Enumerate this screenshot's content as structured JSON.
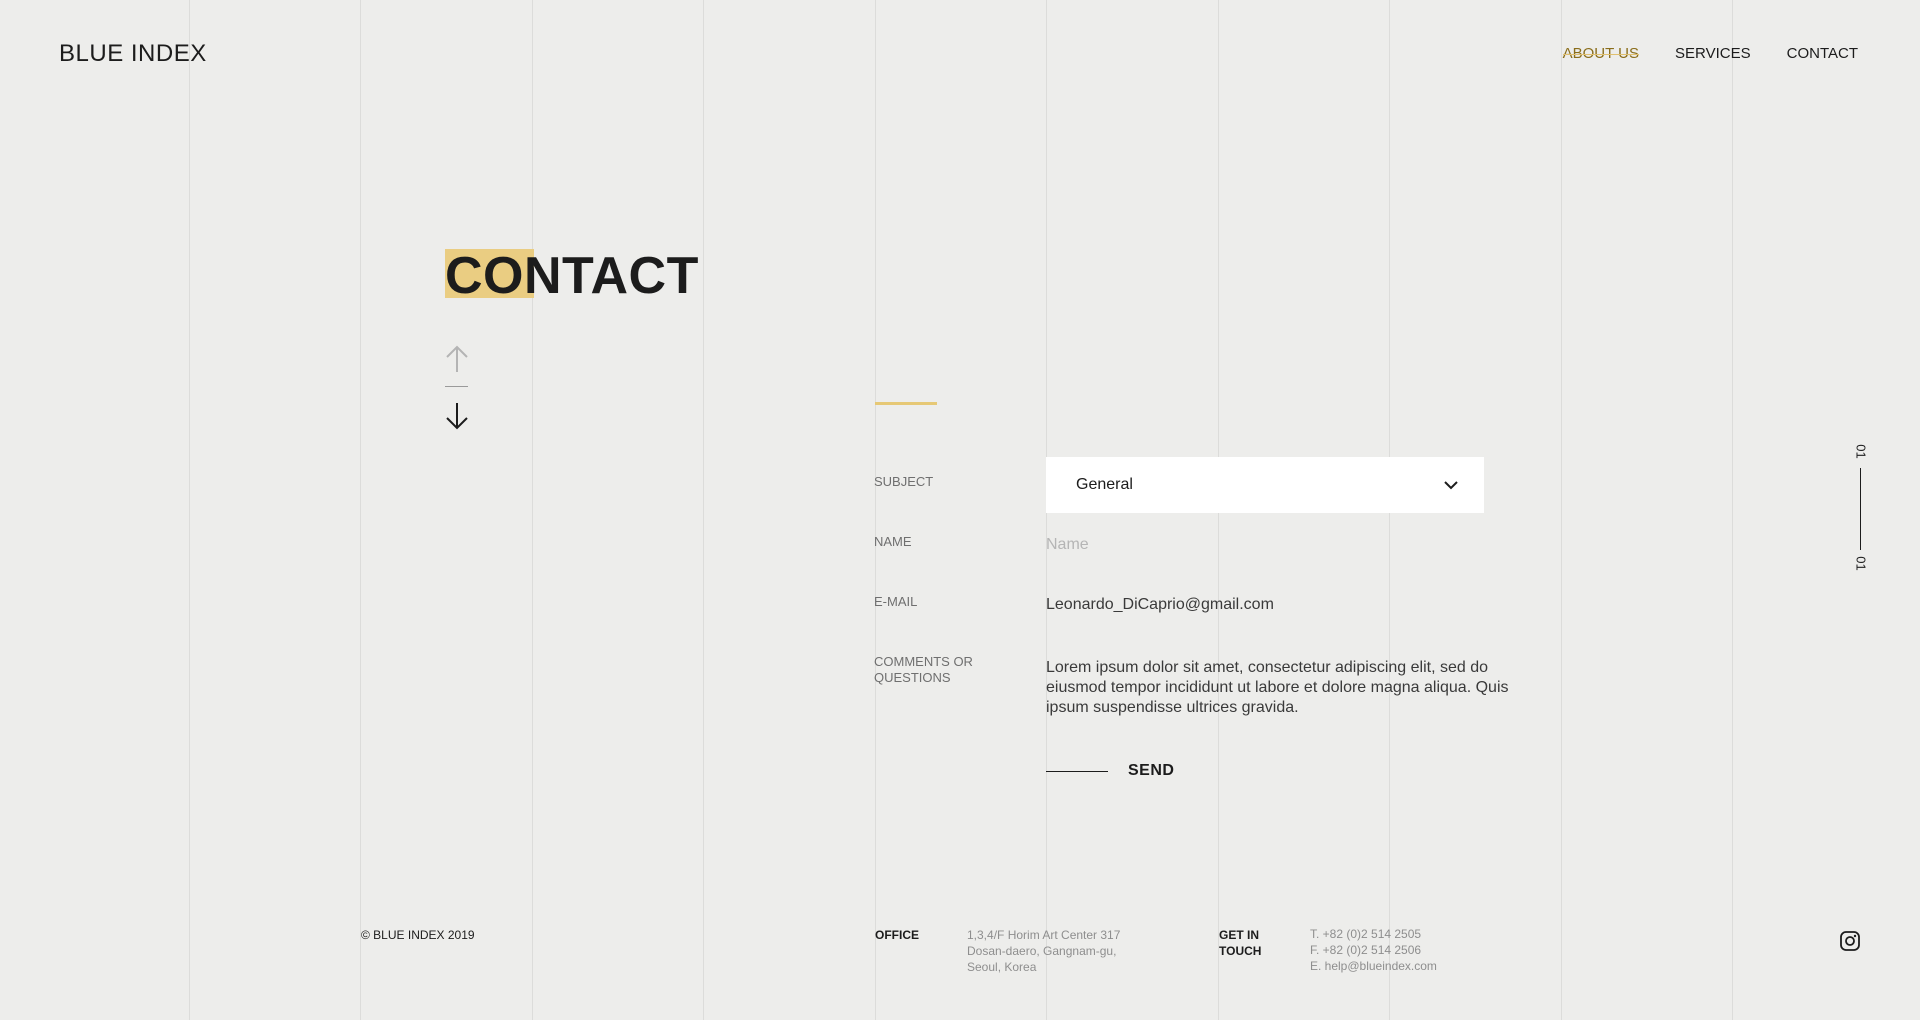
{
  "brand": {
    "logo": "BLUE INDEX"
  },
  "nav": {
    "items": [
      {
        "label": "ABOUT US",
        "active": true
      },
      {
        "label": "SERVICES",
        "active": false
      },
      {
        "label": "CONTACT",
        "active": false
      }
    ]
  },
  "page": {
    "title": "CONTACT"
  },
  "form": {
    "subject": {
      "label": "SUBJECT",
      "value": "General"
    },
    "name": {
      "label": "NAME",
      "placeholder": "Name",
      "value": ""
    },
    "email": {
      "label": "E-MAIL",
      "value": "Leonardo_DiCaprio@gmail.com"
    },
    "comments": {
      "label": "COMMENTS OR QUESTIONS",
      "value": "Lorem ipsum dolor sit amet, consectetur adipiscing elit, sed do eiusmod tempor incididunt ut labore et dolore magna aliqua. Quis ipsum suspendisse ultrices gravida."
    },
    "send_label": "SEND"
  },
  "pager": {
    "current": "01",
    "total": "01"
  },
  "footer": {
    "copyright": "© BLUE INDEX 2019",
    "office_heading": "OFFICE",
    "office_lines": [
      "1,3,4/F Horim Art Center 317",
      "Dosan-daero, Gangnam-gu,",
      "Seoul, Korea"
    ],
    "contact_heading": "GET IN TOUCH",
    "contact_lines": [
      "T. +82 (0)2 514 2505",
      "F. +82 (0)2 514 2506",
      "E. help@blueindex.com"
    ]
  },
  "icons": {
    "arrow_up": "arrow-up-icon",
    "arrow_down": "arrow-down-icon",
    "chevron": "chevron-down-icon",
    "instagram": "instagram-icon"
  },
  "colors": {
    "accent": "#eacd82",
    "background": "#ededeb",
    "text": "#1c1c1c"
  }
}
